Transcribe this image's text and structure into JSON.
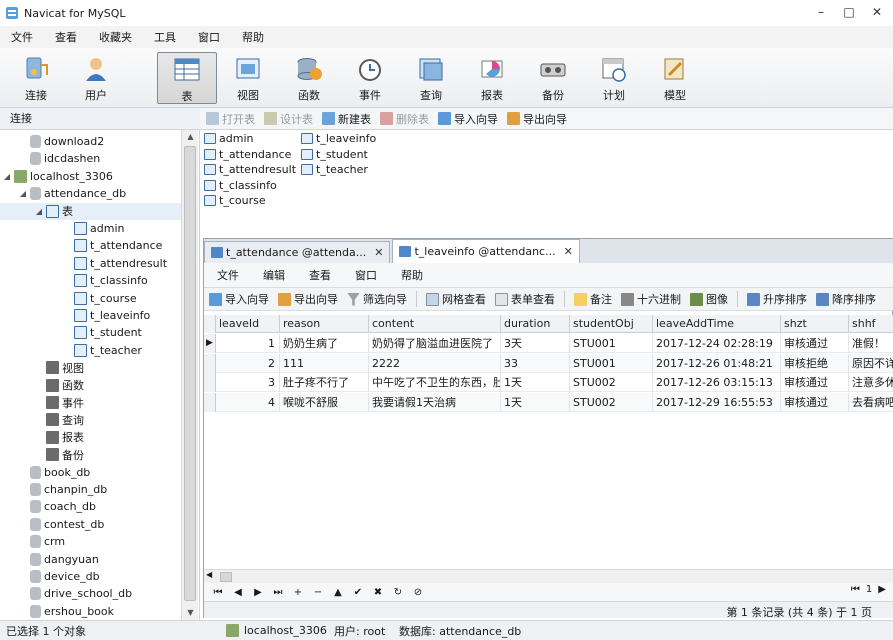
{
  "window": {
    "title": "Navicat for MySQL",
    "minimize_glyph": "–",
    "maximize_glyph": "□",
    "close_glyph": "✕"
  },
  "menubar": [
    "文件",
    "查看",
    "收藏夹",
    "工具",
    "窗口",
    "帮助"
  ],
  "toolbar": [
    {
      "label": "连接",
      "icon": "connection-icon",
      "active": false
    },
    {
      "label": "用户",
      "icon": "user-icon",
      "active": false
    },
    {
      "label": "表",
      "icon": "table-icon",
      "active": true
    },
    {
      "label": "视图",
      "icon": "view-icon",
      "active": false
    },
    {
      "label": "函数",
      "icon": "function-icon",
      "active": false
    },
    {
      "label": "事件",
      "icon": "event-icon",
      "active": false
    },
    {
      "label": "查询",
      "icon": "query-icon",
      "active": false
    },
    {
      "label": "报表",
      "icon": "report-icon",
      "active": false
    },
    {
      "label": "备份",
      "icon": "backup-icon",
      "active": false
    },
    {
      "label": "计划",
      "icon": "schedule-icon",
      "active": false
    },
    {
      "label": "模型",
      "icon": "model-icon",
      "active": false
    }
  ],
  "connection_header": "连接",
  "object_toolbar": [
    {
      "label": "打开表",
      "disabled": true
    },
    {
      "label": "设计表",
      "disabled": true
    },
    {
      "label": "新建表",
      "disabled": false
    },
    {
      "label": "删除表",
      "disabled": true
    },
    {
      "label": "导入向导",
      "disabled": false
    },
    {
      "label": "导出向导",
      "disabled": false
    }
  ],
  "sidebar": {
    "items": [
      {
        "label": "download2",
        "icon": "database-icon",
        "expander": ""
      },
      {
        "label": "idcdashen",
        "icon": "database-icon",
        "expander": ""
      },
      {
        "label": "localhost_3306",
        "icon": "server-icon",
        "expander": "◢"
      },
      {
        "label": "attendance_db",
        "icon": "database-icon",
        "expander": "◢"
      },
      {
        "label": "表",
        "icon": "tables-folder-icon",
        "expander": "◢"
      },
      {
        "label": "admin",
        "icon": "table-icon",
        "expander": ""
      },
      {
        "label": "t_attendance",
        "icon": "table-icon",
        "expander": ""
      },
      {
        "label": "t_attendresult",
        "icon": "table-icon",
        "expander": ""
      },
      {
        "label": "t_classinfo",
        "icon": "table-icon",
        "expander": ""
      },
      {
        "label": "t_course",
        "icon": "table-icon",
        "expander": ""
      },
      {
        "label": "t_leaveinfo",
        "icon": "table-icon",
        "expander": ""
      },
      {
        "label": "t_student",
        "icon": "table-icon",
        "expander": ""
      },
      {
        "label": "t_teacher",
        "icon": "table-icon",
        "expander": ""
      },
      {
        "label": "视图",
        "icon": "view-icon",
        "expander": ""
      },
      {
        "label": "函数",
        "icon": "function-icon",
        "expander": ""
      },
      {
        "label": "事件",
        "icon": "event-icon",
        "expander": ""
      },
      {
        "label": "查询",
        "icon": "query-icon",
        "expander": ""
      },
      {
        "label": "报表",
        "icon": "report-icon",
        "expander": ""
      },
      {
        "label": "备份",
        "icon": "backup-icon",
        "expander": ""
      },
      {
        "label": "book_db",
        "icon": "database-icon",
        "expander": ""
      },
      {
        "label": "chanpin_db",
        "icon": "database-icon",
        "expander": ""
      },
      {
        "label": "coach_db",
        "icon": "database-icon",
        "expander": ""
      },
      {
        "label": "contest_db",
        "icon": "database-icon",
        "expander": ""
      },
      {
        "label": "crm",
        "icon": "database-icon",
        "expander": ""
      },
      {
        "label": "dangyuan",
        "icon": "database-icon",
        "expander": ""
      },
      {
        "label": "device_db",
        "icon": "database-icon",
        "expander": ""
      },
      {
        "label": "drive_school_db",
        "icon": "database-icon",
        "expander": ""
      },
      {
        "label": "ershou_book",
        "icon": "database-icon",
        "expander": ""
      }
    ]
  },
  "objects": {
    "column1": [
      "admin",
      "t_attendance",
      "t_attendresult",
      "t_classinfo",
      "t_course"
    ],
    "column2": [
      "t_leaveinfo",
      "t_student",
      "t_teacher"
    ]
  },
  "editor": {
    "tabs": [
      {
        "label": "t_attendance @attenda...",
        "active": false,
        "close": "✕"
      },
      {
        "label": "t_leaveinfo @attendanc...",
        "active": true,
        "close": "✕"
      }
    ],
    "menu": [
      "文件",
      "编辑",
      "查看",
      "窗口",
      "帮助"
    ],
    "toolbar": [
      "导入向导",
      "导出向导",
      "筛选向导",
      "网格查看",
      "表单查看",
      "备注",
      "十六进制",
      "图像",
      "升序排序",
      "降序排序"
    ],
    "columns": [
      "leaveId",
      "reason",
      "content",
      "duration",
      "studentObj",
      "leaveAddTime",
      "shzt",
      "shhf"
    ],
    "rows": [
      [
        "1",
        "奶奶生病了",
        "奶奶得了脑溢血进医院了",
        "3天",
        "STU001",
        "2017-12-24 02:28:19",
        "审核通过",
        "准假！"
      ],
      [
        "2",
        "111",
        "2222",
        "33",
        "STU001",
        "2017-12-26 01:48:21",
        "审核拒绝",
        "原因不详"
      ],
      [
        "3",
        "肚子疼不行了",
        "中午吃了不卫生的东西，肚子",
        "1天",
        "STU002",
        "2017-12-26 03:15:13",
        "审核通过",
        "注意多休"
      ],
      [
        "4",
        "喉咙不舒服",
        "我要请假1天治病",
        "1天",
        "STU002",
        "2017-12-29 16:55:53",
        "审核通过",
        "去看病吧"
      ]
    ],
    "current_row_marker": "▶",
    "nav_buttons": [
      "⏮",
      "◀",
      "▶",
      "⏭",
      "+",
      "−",
      "▲",
      "✔",
      "✖",
      "↻",
      "⊘"
    ],
    "page_info": "第 1 条记录 (共 4 条) 于 1 页",
    "page_nav": [
      "⏮",
      "1",
      "▶"
    ]
  },
  "statusbar": {
    "selection": "已选择 1 个对象",
    "connection": "localhost_3306",
    "user": "用户: root",
    "database": "数据库: attendance_db"
  },
  "colors": {
    "selection": "#e5eef9",
    "accent": "#3a7bd5",
    "table_icon": "#4f88c6"
  }
}
